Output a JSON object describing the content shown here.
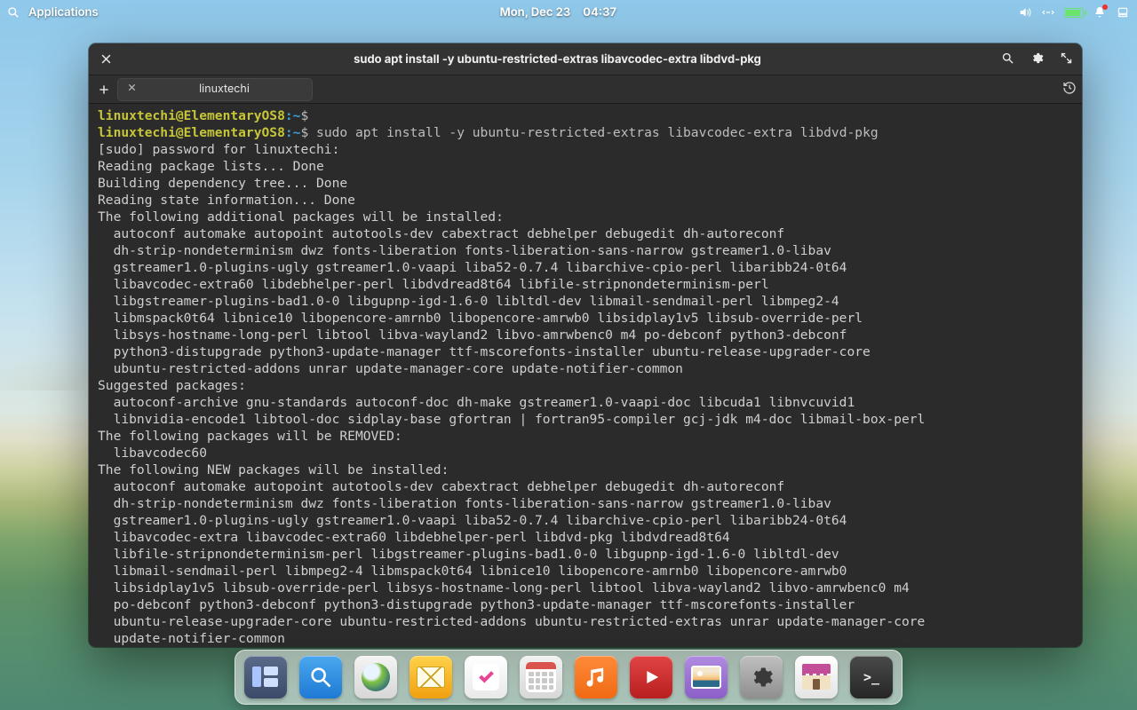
{
  "panel": {
    "apps_label": "Applications",
    "date": "Mon, Dec 23",
    "time": "04:37"
  },
  "window": {
    "title": "sudo apt install -y ubuntu-restricted-extras libavcodec-extra libdvd-pkg",
    "tab_label": "linuxtechi"
  },
  "term": {
    "user": "linuxtechi@ElementaryOS8",
    "path": "~",
    "prompt": "$",
    "cmd": "sudo apt install -y ubuntu-restricted-extras libavcodec-extra libdvd-pkg",
    "out": "[sudo] password for linuxtechi:\nReading package lists... Done\nBuilding dependency tree... Done\nReading state information... Done\nThe following additional packages will be installed:\n  autoconf automake autopoint autotools-dev cabextract debhelper debugedit dh-autoreconf\n  dh-strip-nondeterminism dwz fonts-liberation fonts-liberation-sans-narrow gstreamer1.0-libav\n  gstreamer1.0-plugins-ugly gstreamer1.0-vaapi liba52-0.7.4 libarchive-cpio-perl libaribb24-0t64\n  libavcodec-extra60 libdebhelper-perl libdvdread8t64 libfile-stripnondeterminism-perl\n  libgstreamer-plugins-bad1.0-0 libgupnp-igd-1.6-0 libltdl-dev libmail-sendmail-perl libmpeg2-4\n  libmspack0t64 libnice10 libopencore-amrnb0 libopencore-amrwb0 libsidplay1v5 libsub-override-perl\n  libsys-hostname-long-perl libtool libva-wayland2 libvo-amrwbenc0 m4 po-debconf python3-debconf\n  python3-distupgrade python3-update-manager ttf-mscorefonts-installer ubuntu-release-upgrader-core\n  ubuntu-restricted-addons unrar update-manager-core update-notifier-common\nSuggested packages:\n  autoconf-archive gnu-standards autoconf-doc dh-make gstreamer1.0-vaapi-doc libcuda1 libnvcuvid1\n  libnvidia-encode1 libtool-doc sidplay-base gfortran | fortran95-compiler gcj-jdk m4-doc libmail-box-perl\nThe following packages will be REMOVED:\n  libavcodec60\nThe following NEW packages will be installed:\n  autoconf automake autopoint autotools-dev cabextract debhelper debugedit dh-autoreconf\n  dh-strip-nondeterminism dwz fonts-liberation fonts-liberation-sans-narrow gstreamer1.0-libav\n  gstreamer1.0-plugins-ugly gstreamer1.0-vaapi liba52-0.7.4 libarchive-cpio-perl libaribb24-0t64\n  libavcodec-extra libavcodec-extra60 libdebhelper-perl libdvd-pkg libdvdread8t64\n  libfile-stripnondeterminism-perl libgstreamer-plugins-bad1.0-0 libgupnp-igd-1.6-0 libltdl-dev\n  libmail-sendmail-perl libmpeg2-4 libmspack0t64 libnice10 libopencore-amrnb0 libopencore-amrwb0\n  libsidplay1v5 libsub-override-perl libsys-hostname-long-perl libtool libva-wayland2 libvo-amrwbenc0 m4\n  po-debconf python3-debconf python3-distupgrade python3-update-manager ttf-mscorefonts-installer\n  ubuntu-release-upgrader-core ubuntu-restricted-addons ubuntu-restricted-extras unrar update-manager-core\n  update-notifier-common"
  },
  "dock": {
    "items": [
      "multitasking-view",
      "files",
      "web-browser",
      "mail",
      "tasks",
      "calendar",
      "music",
      "videos",
      "photos",
      "system-settings",
      "appcenter",
      "terminal"
    ]
  }
}
